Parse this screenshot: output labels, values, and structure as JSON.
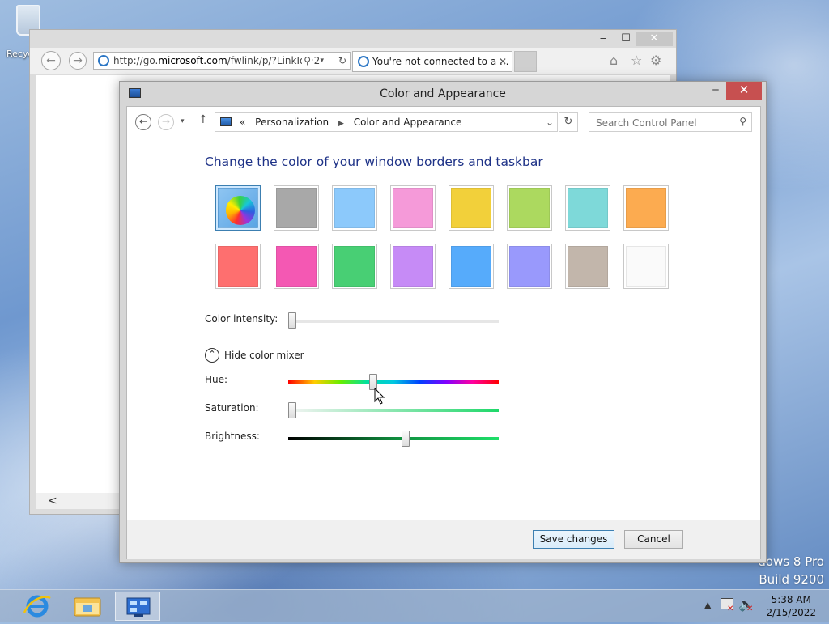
{
  "desktop": {
    "recycle_bin_label": "Recyc",
    "watermark_line1": "dows 8 Pro",
    "watermark_line2": "Build 9200"
  },
  "browser": {
    "address": "http://go.microsoft.com/fwlink/p/?LinkId=2",
    "address_prefix": "http://go.",
    "address_host": "microsoft.com",
    "address_suffix": "/fwlink/p/?LinkId=2",
    "tab_title": "You're not connected to a ...",
    "tab_close": "✕",
    "window_min": "‒",
    "window_max": "☐",
    "window_close": "✕",
    "scroll_left": "<"
  },
  "dialog": {
    "title": "Color and Appearance",
    "breadcrumb_prefix": "«",
    "breadcrumb": [
      "Personalization",
      "Color and Appearance"
    ],
    "search_placeholder": "Search Control Panel",
    "heading": "Change the color of your window borders and taskbar",
    "swatches": [
      {
        "name": "automatic",
        "color": "#6fb0ea",
        "selected": true
      },
      {
        "name": "gray",
        "color": "#a8a8a8"
      },
      {
        "name": "light-blue",
        "color": "#8cc9fb"
      },
      {
        "name": "pink",
        "color": "#f59ad9"
      },
      {
        "name": "yellow",
        "color": "#f2d03a"
      },
      {
        "name": "lime",
        "color": "#acd95f"
      },
      {
        "name": "teal",
        "color": "#7ed9d9"
      },
      {
        "name": "orange",
        "color": "#fcab50"
      },
      {
        "name": "red",
        "color": "#fe6f6f"
      },
      {
        "name": "magenta",
        "color": "#f458b3"
      },
      {
        "name": "green",
        "color": "#48cf74"
      },
      {
        "name": "purple",
        "color": "#c68bf6"
      },
      {
        "name": "blue",
        "color": "#56abfb"
      },
      {
        "name": "periwinkle",
        "color": "#9999fc"
      },
      {
        "name": "taupe",
        "color": "#c2b6ab"
      },
      {
        "name": "white",
        "color": "#fafafa"
      }
    ],
    "color_intensity_label": "Color intensity:",
    "color_intensity": 0.0,
    "hide_mixer_label": "Hide color mixer",
    "hue_label": "Hue:",
    "hue": 0.4,
    "saturation_label": "Saturation:",
    "saturation": 0.0,
    "brightness_label": "Brightness:",
    "brightness": 0.56,
    "save_label": "Save changes",
    "cancel_label": "Cancel"
  },
  "taskbar": {
    "time": "5:38 AM",
    "date": "2/15/2022"
  }
}
